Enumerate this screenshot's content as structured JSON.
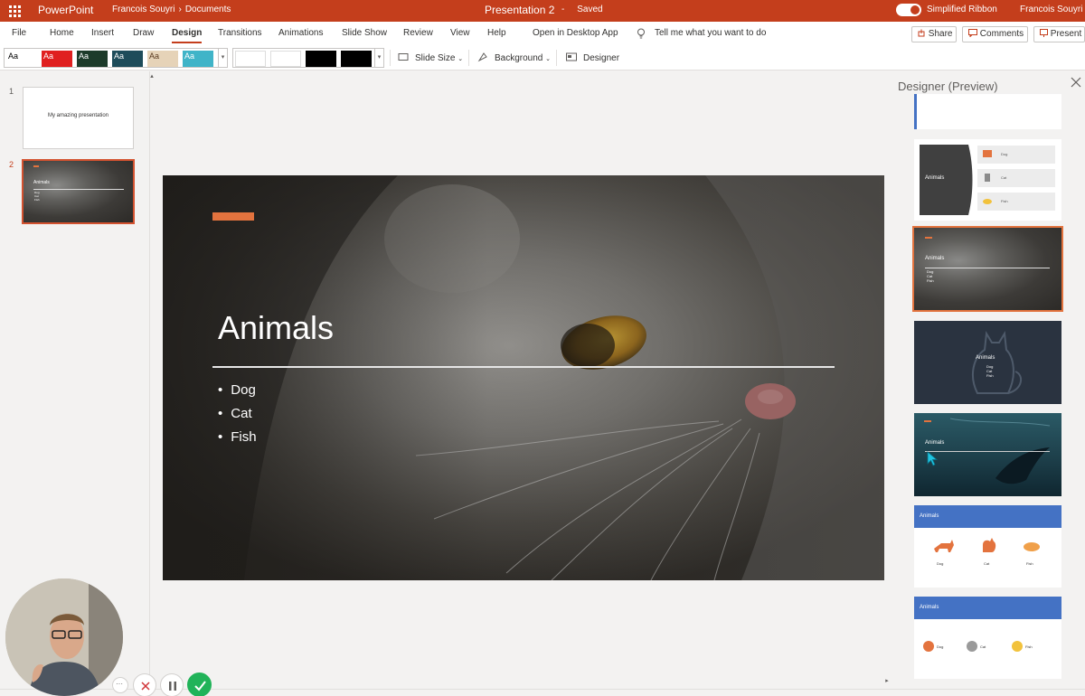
{
  "titlebar": {
    "app_name": "PowerPoint",
    "owner": "Francois Souyri",
    "folder": "Documents",
    "crumb_separator": "›",
    "document_title": "Presentation 2",
    "save_separator": "-",
    "save_status": "Saved",
    "ribbon_toggle_label": "Simplified Ribbon",
    "user_name": "Francois Souyri"
  },
  "tabs": [
    {
      "label": "File"
    },
    {
      "label": "Home"
    },
    {
      "label": "Insert"
    },
    {
      "label": "Draw"
    },
    {
      "label": "Design",
      "active": true
    },
    {
      "label": "Transitions"
    },
    {
      "label": "Animations"
    },
    {
      "label": "Slide Show"
    },
    {
      "label": "Review"
    },
    {
      "label": "View"
    },
    {
      "label": "Help"
    }
  ],
  "ribbon_extras": {
    "open_desktop": "Open in Desktop App",
    "tell_me": "Tell me what you want to do",
    "share": "Share",
    "comments": "Comments",
    "present": "Present"
  },
  "themes": [
    {
      "label": "Aa",
      "bg": "#ffffff",
      "fg": "#000000"
    },
    {
      "label": "Aa",
      "bg": "#e02020",
      "fg": "#ffffff"
    },
    {
      "label": "Aa",
      "bg": "#1d3b2a",
      "fg": "#ffffff"
    },
    {
      "label": "Aa",
      "bg": "#1e4c5a",
      "fg": "#ffffff"
    },
    {
      "label": "Aa",
      "bg": "#e6d3b8",
      "fg": "#5a3a20"
    },
    {
      "label": "Aa",
      "bg": "#40b4c8",
      "fg": "#ffffff"
    }
  ],
  "variants": [
    {
      "bg": "#ffffff"
    },
    {
      "bg": "#ffffff"
    },
    {
      "bg": "#000000"
    },
    {
      "bg": "#000000"
    }
  ],
  "commands": {
    "slide_size": "Slide Size",
    "background": "Background",
    "designer": "Designer"
  },
  "thumbnails": {
    "slide1_number": "1",
    "slide1_text": "My amazing presentation",
    "slide2_number": "2"
  },
  "slide": {
    "title": "Animals",
    "bullets": [
      "Dog",
      "Cat",
      "Fish"
    ]
  },
  "designer": {
    "title": "Designer (Preview)",
    "card_title": "Animals",
    "card_items": [
      "Dog",
      "Cat",
      "Fish"
    ]
  },
  "colors": {
    "brand": "#c43e1c",
    "accent": "#e3733e",
    "designer_blue": "#4472c4"
  }
}
